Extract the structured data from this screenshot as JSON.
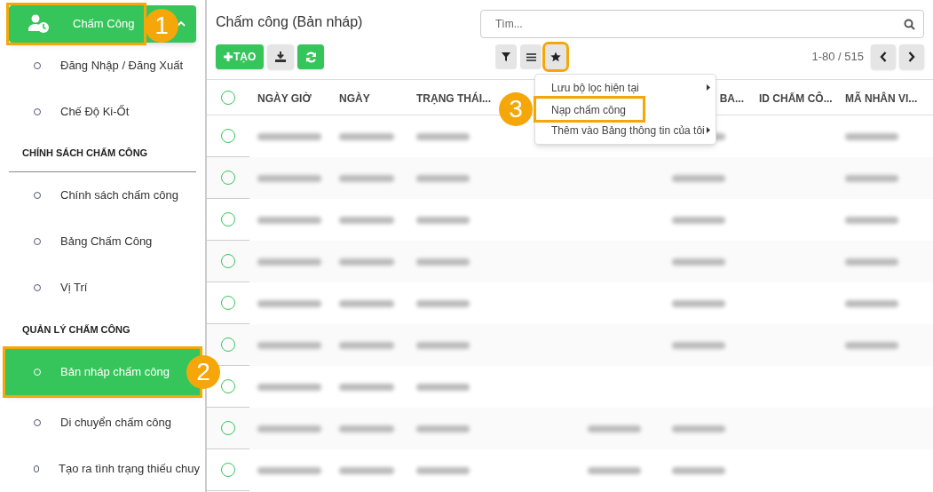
{
  "sidebar": {
    "header": {
      "label": "Chấm Công",
      "expanded": true,
      "highlighted": true,
      "badge": "1"
    },
    "items": [
      {
        "kind": "item",
        "label": "Đăng Nhập / Đăng Xuất",
        "selected": false,
        "highlighted": false
      },
      {
        "kind": "item",
        "label": "Chế Độ Ki-Ốt",
        "selected": false,
        "highlighted": false
      },
      {
        "kind": "section",
        "label": "CHÍNH SÁCH CHẤM CÔNG"
      },
      {
        "kind": "item",
        "label": "Chính sách chấm công",
        "selected": false,
        "highlighted": false
      },
      {
        "kind": "item",
        "label": "Bảng Chấm Công",
        "selected": false,
        "highlighted": false
      },
      {
        "kind": "item",
        "label": "Vị Trí",
        "selected": false,
        "highlighted": false
      },
      {
        "kind": "section",
        "label": "QUẢN LÝ CHẤM CÔNG"
      },
      {
        "kind": "item",
        "label": "Bản nháp chấm công",
        "selected": true,
        "highlighted": true,
        "badge": "2"
      },
      {
        "kind": "item",
        "label": "Di chuyển chấm công",
        "selected": false,
        "highlighted": false
      },
      {
        "kind": "item",
        "label": "Tạo ra tình trạng thiếu chuy",
        "selected": false,
        "highlighted": false
      }
    ]
  },
  "title": "Chấm công (Bản nháp)",
  "search": {
    "placeholder": "Tìm..."
  },
  "toolbar": {
    "create": "TẠO",
    "pager": "1-80 / 515",
    "star_highlighted": true
  },
  "favorites_menu": {
    "badge": "3",
    "items": [
      {
        "label": "Lưu bộ lọc hiện tại",
        "submenu": true,
        "highlighted": false
      },
      {
        "label": "Nạp chấm công",
        "submenu": false,
        "highlighted": true
      },
      {
        "label": "Thêm vào Bảng thông tin của tôi",
        "submenu": true,
        "highlighted": false
      }
    ]
  },
  "table": {
    "select_all_checked": false,
    "columns": {
      "column_1": "NGÀY GIỜ",
      "column_2": "NGÀY",
      "column_3": "TRẠNG THÁI...",
      "column_6": "BA...",
      "column_7": "ID CHẤM CÔ...",
      "column_8": "MÃ NHÂN VI..."
    },
    "rows": [
      {
        "checked": false,
        "blurred": [
          true,
          true,
          true,
          false,
          false,
          true,
          false,
          true
        ]
      },
      {
        "checked": false,
        "blurred": [
          true,
          true,
          true,
          false,
          false,
          true,
          false,
          true
        ]
      },
      {
        "checked": false,
        "blurred": [
          true,
          true,
          true,
          false,
          false,
          true,
          false,
          true
        ]
      },
      {
        "checked": false,
        "blurred": [
          true,
          true,
          true,
          false,
          false,
          true,
          false,
          true
        ]
      },
      {
        "checked": false,
        "blurred": [
          true,
          true,
          true,
          false,
          false,
          true,
          false,
          true
        ]
      },
      {
        "checked": false,
        "blurred": [
          true,
          true,
          true,
          false,
          false,
          true,
          false,
          true
        ]
      },
      {
        "checked": false,
        "blurred": [
          true,
          true,
          true,
          false,
          false,
          false,
          false,
          false
        ]
      },
      {
        "checked": false,
        "blurred": [
          true,
          true,
          true,
          false,
          true,
          true,
          false,
          false
        ]
      },
      {
        "checked": false,
        "blurred": [
          true,
          true,
          true,
          false,
          true,
          true,
          false,
          false
        ]
      }
    ]
  }
}
